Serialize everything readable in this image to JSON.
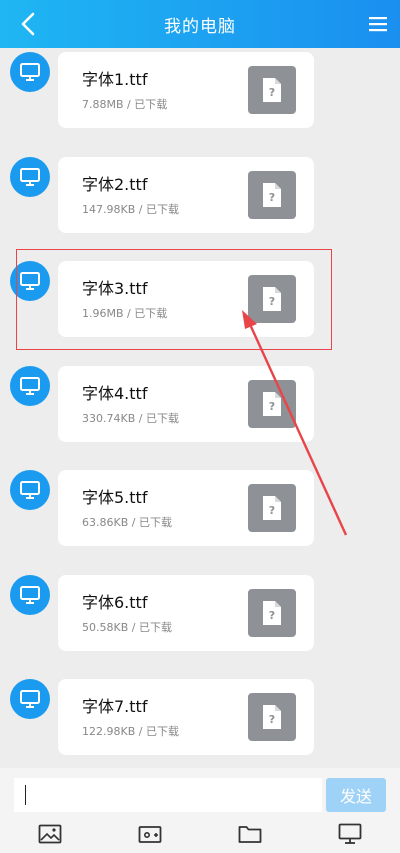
{
  "header": {
    "title": "我的电脑",
    "back_icon": "back-icon",
    "menu_icon": "menu-icon"
  },
  "messages": [
    {
      "name": "字体1.ttf",
      "meta": "7.88MB / 已下载"
    },
    {
      "name": "字体2.ttf",
      "meta": "147.98KB / 已下载"
    },
    {
      "name": "字体3.ttf",
      "meta": "1.96MB / 已下载"
    },
    {
      "name": "字体4.ttf",
      "meta": "330.74KB / 已下载"
    },
    {
      "name": "字体5.ttf",
      "meta": "63.86KB / 已下载"
    },
    {
      "name": "字体6.ttf",
      "meta": "50.58KB / 已下载"
    },
    {
      "name": "字体7.ttf",
      "meta": "122.98KB / 已下载"
    }
  ],
  "input_bar": {
    "send_label": "发送",
    "input_value": ""
  },
  "toolbar": {
    "icons": [
      "image-icon",
      "camera-icon",
      "folder-icon",
      "computer-icon"
    ]
  },
  "colors": {
    "header_start": "#1fb6f2",
    "header_end": "#1a8ff0",
    "avatar": "#1a9bf0",
    "file_icon": "#8e9296",
    "highlight": "#e8454a",
    "send_button": "#9fd2f7"
  }
}
